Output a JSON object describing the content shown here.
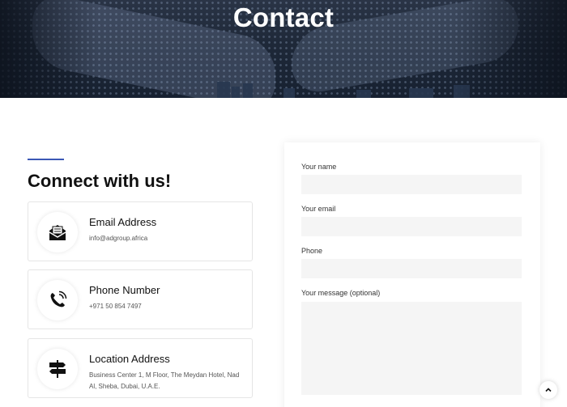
{
  "hero": {
    "title": "Contact"
  },
  "section": {
    "title": "Connect with us!"
  },
  "cards": [
    {
      "icon": "envelope-icon",
      "title": "Email Address",
      "text": "info@adgroup.africa"
    },
    {
      "icon": "phone-icon",
      "title": "Phone Number",
      "text": "+971 50 854 7497"
    },
    {
      "icon": "signpost-icon",
      "title": "Location Address",
      "text": "Business Center 1, M Floor, The Meydan Hotel, Nad Al, Sheba, Dubai, U.A.E."
    }
  ],
  "form": {
    "name_label": "Your name",
    "email_label": "Your email",
    "phone_label": "Phone",
    "message_label": "Your message (optional)"
  },
  "colors": {
    "accent": "#3b57b5",
    "hero_bg": "#1e2838",
    "input_bg": "#f5f5f5"
  },
  "scroll_top": {
    "icon": "chevron-up-icon"
  }
}
